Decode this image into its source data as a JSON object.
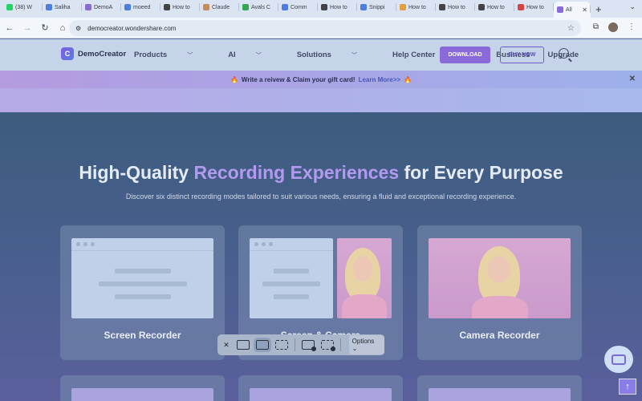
{
  "browser": {
    "tabs": [
      {
        "label": "(38) W",
        "color": "#25d366"
      },
      {
        "label": "Saliha",
        "color": "#4a7fe0"
      },
      {
        "label": "DemoA",
        "color": "#8a6ad8"
      },
      {
        "label": "moeed",
        "color": "#4a7fe0"
      },
      {
        "label": "How to",
        "color": "#444"
      },
      {
        "label": "Claude",
        "color": "#c98a5a"
      },
      {
        "label": "Avals C",
        "color": "#2fa84f"
      },
      {
        "label": "Comm",
        "color": "#4a7fe0"
      },
      {
        "label": "How to",
        "color": "#444"
      },
      {
        "label": "Snippi",
        "color": "#4a7fe0"
      },
      {
        "label": "How to",
        "color": "#e0a040"
      },
      {
        "label": "How to",
        "color": "#444"
      },
      {
        "label": "How to",
        "color": "#444"
      },
      {
        "label": "How to",
        "color": "#d64545"
      },
      {
        "label": "All",
        "color": "#8a6ad8",
        "active": true
      }
    ],
    "new_tab": "+",
    "url": "democreator.wondershare.com"
  },
  "site": {
    "logo": "DemoCreator",
    "nav": [
      "Products",
      "AI",
      "Solutions",
      "Help Center",
      "Business",
      "Upgrade"
    ],
    "download": "DOWNLOAD",
    "buy_now": "BUY NOW"
  },
  "promo": {
    "text": "Write a reivew & Claim your gift card!",
    "link": "Learn More>>"
  },
  "hero": {
    "title_pre": "High-Quality ",
    "title_accent": "Recording Experiences",
    "title_post": " for Every Purpose",
    "subtitle": "Discover six distinct recording modes tailored to suit various needs, ensuring a fluid and exceptional recording experience."
  },
  "cards": [
    {
      "label": "Screen Recorder"
    },
    {
      "label": "Screen & Camera"
    },
    {
      "label": "Camera Recorder"
    }
  ],
  "snipping": {
    "options": "Options"
  },
  "colors": {
    "accent": "#8a6ad8",
    "hero_accent": "#b39af0"
  }
}
